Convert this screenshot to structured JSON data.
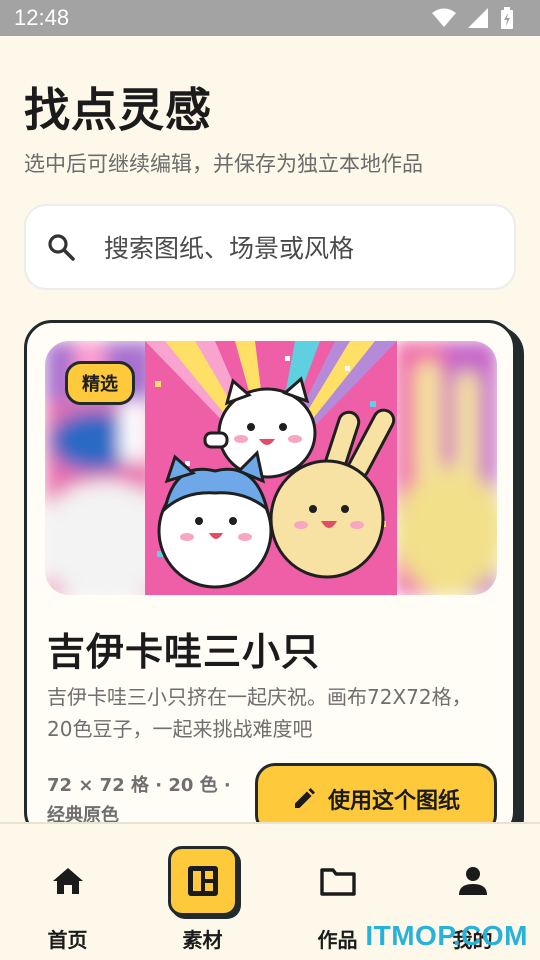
{
  "status_bar": {
    "time": "12:48",
    "icons": [
      "wifi-icon",
      "signal-icon",
      "battery-charging-icon"
    ]
  },
  "header": {
    "title": "找点灵感",
    "subtitle": "选中后可继续编辑，并保存为独立本地作品"
  },
  "search": {
    "icon": "search-icon",
    "placeholder": "搜索图纸、场景或风格"
  },
  "featured_card": {
    "badge": "精选",
    "title": "吉伊卡哇三小只",
    "description": "吉伊卡哇三小只挤在一起庆祝。画布72X72格，20色豆子，一起来挑战难度吧",
    "meta": "72 × 72 格 · 20 色 · 经典原色",
    "button_label": "使用这个图纸",
    "button_icon": "pencil-icon"
  },
  "bottom_nav": {
    "items": [
      {
        "label": "首页",
        "icon": "home-icon",
        "active": false
      },
      {
        "label": "素材",
        "icon": "materials-grid-icon",
        "active": true
      },
      {
        "label": "作品",
        "icon": "folder-icon",
        "active": false
      },
      {
        "label": "我的",
        "icon": "person-icon",
        "active": false
      }
    ]
  },
  "watermark": "ITMOP.COM",
  "colors": {
    "background": "#fdf8ea",
    "accent": "#ffc93c",
    "outline": "#222a2c",
    "watermark": "#27b3d9"
  }
}
